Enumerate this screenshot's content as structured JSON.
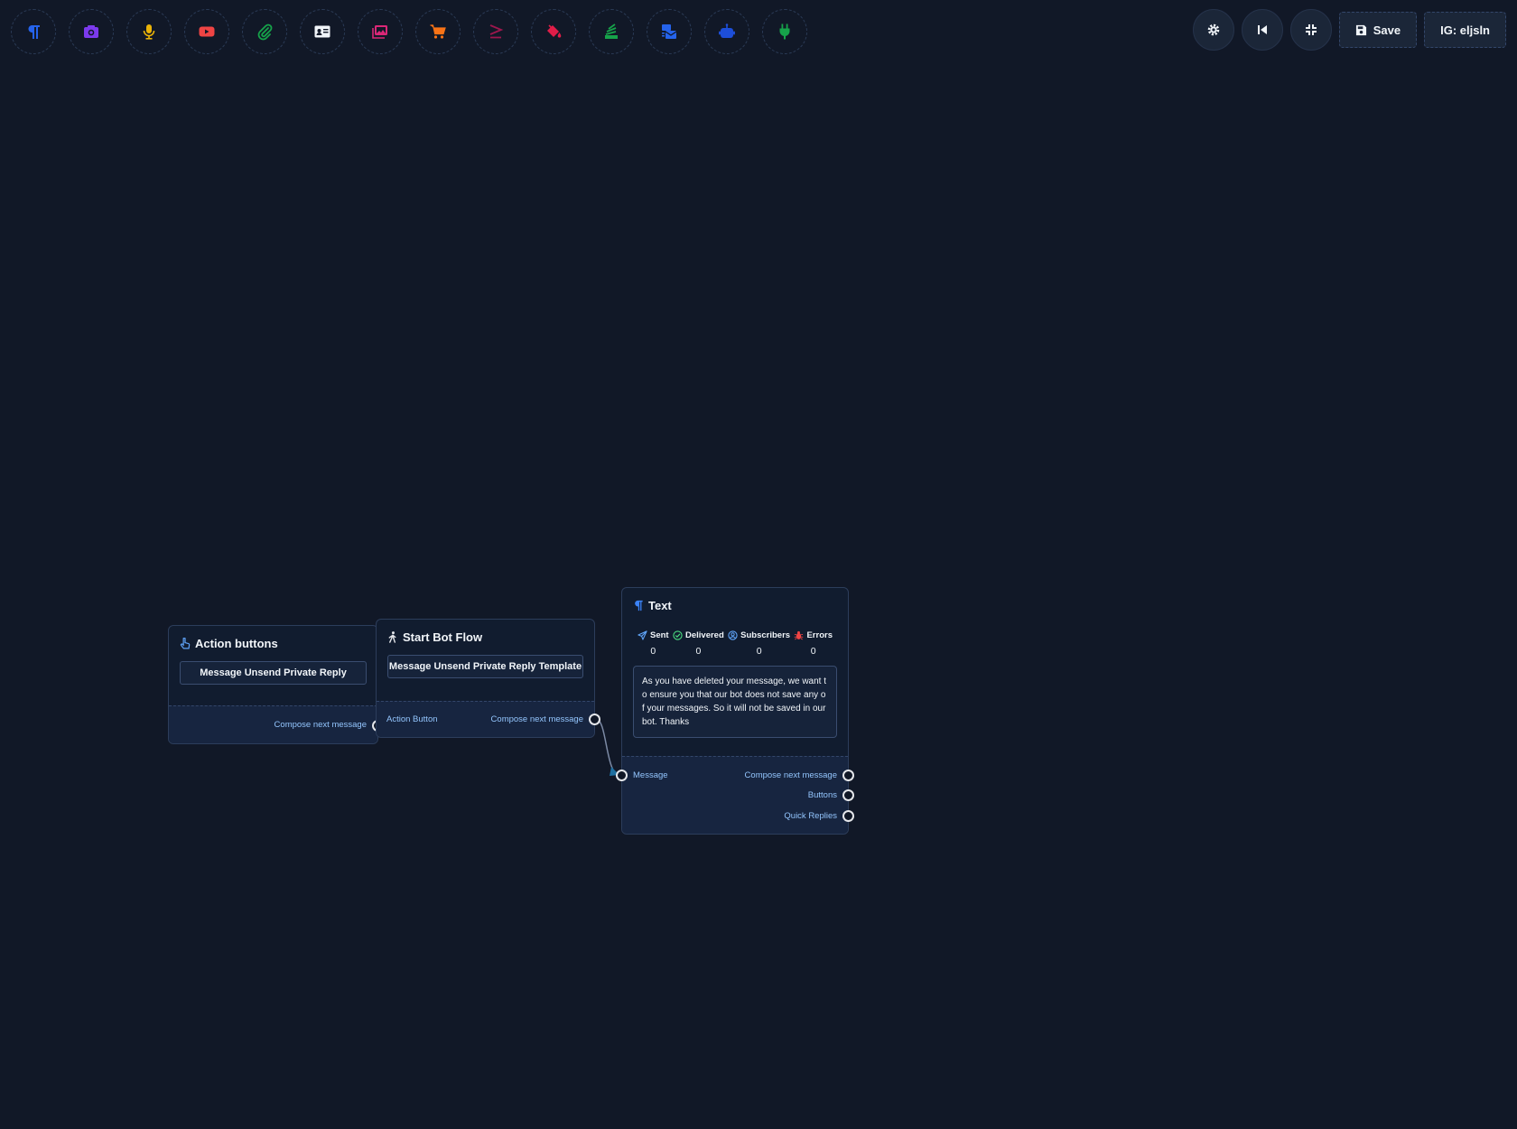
{
  "toolbar": {
    "tools": [
      {
        "icon": "paragraph-icon",
        "color": "#2563eb"
      },
      {
        "icon": "camera-icon",
        "color": "#7c3aed"
      },
      {
        "icon": "microphone-icon",
        "color": "#eab308"
      },
      {
        "icon": "youtube-icon",
        "color": "#ef4444"
      },
      {
        "icon": "paperclip-icon",
        "color": "#16a34a"
      },
      {
        "icon": "id-card-icon",
        "color": "#f1f5f9"
      },
      {
        "icon": "images-icon",
        "color": "#db2777"
      },
      {
        "icon": "cart-icon",
        "color": "#f97316"
      },
      {
        "icon": "greater-equal-icon",
        "color": "#9d174d"
      },
      {
        "icon": "paint-bucket-icon",
        "color": "#e11d48"
      },
      {
        "icon": "stack-icon",
        "color": "#16a34a"
      },
      {
        "icon": "mail-bulk-icon",
        "color": "#2563eb"
      },
      {
        "icon": "robot-icon",
        "color": "#1d4ed8"
      },
      {
        "icon": "plug-icon",
        "color": "#16a34a"
      }
    ],
    "save_label": "Save",
    "account_label": "IG: eljsln"
  },
  "nodes": {
    "action_buttons": {
      "title": "Action buttons",
      "field": "Message Unsend Private Reply",
      "out_label": "Compose next message"
    },
    "start_bot_flow": {
      "title": "Start Bot Flow",
      "field": "Message Unsend Private Reply Template",
      "in_label": "Action Button",
      "out_label": "Compose next message"
    },
    "text": {
      "title": "Text",
      "stats": [
        {
          "label": "Sent",
          "value": "0",
          "icon": "send-icon",
          "color": "#60a5fa"
        },
        {
          "label": "Delivered",
          "value": "0",
          "icon": "check-circle-icon",
          "color": "#4ade80"
        },
        {
          "label": "Subscribers",
          "value": "0",
          "icon": "user-circle-icon",
          "color": "#60a5fa"
        },
        {
          "label": "Errors",
          "value": "0",
          "icon": "bug-icon",
          "color": "#ef4444"
        }
      ],
      "message": "As you have deleted your message, we want to ensure you that our bot does not save any of your messages. So it will not be saved in our bot. Thanks",
      "in_label": "Message",
      "outputs": [
        "Compose next message",
        "Buttons",
        "Quick Replies"
      ]
    }
  }
}
